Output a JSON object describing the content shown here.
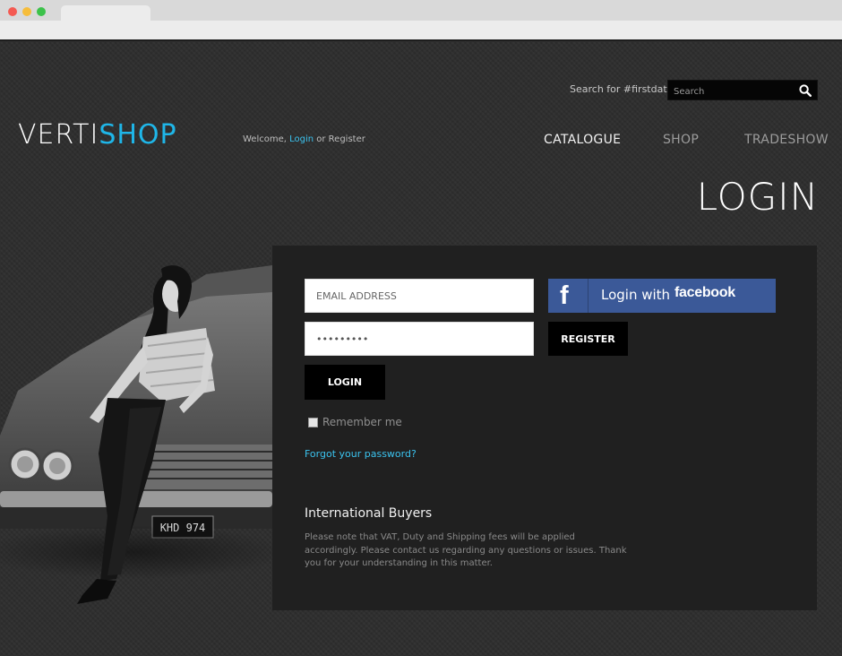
{
  "header": {
    "search_label": "Search for #firstdate",
    "search_placeholder": "Search",
    "welcome_prefix": "Welcome, ",
    "welcome_login": "Login",
    "welcome_suffix": " or Register"
  },
  "logo": {
    "part1": "VERTI",
    "part2": "SHOP"
  },
  "nav": {
    "items": [
      {
        "label": "CATALOGUE"
      },
      {
        "label": "SHOP"
      },
      {
        "label": "TRADESHOW"
      }
    ]
  },
  "page": {
    "title": "LOGIN"
  },
  "form": {
    "email_placeholder": "EMAIL ADDRESS",
    "password_value": "•••••••••",
    "login_label": "LOGIN",
    "register_label": "REGISTER",
    "facebook_prefix": "Login with",
    "facebook_brand": "facebook",
    "remember_label": "Remember me",
    "forgot_label": "Forgot your password?"
  },
  "photo": {
    "plate": "KHD 974"
  },
  "international": {
    "title": "International Buyers",
    "text": "Please note that VAT, Duty and Shipping fees will be applied accordingly. Please contact us regarding any questions or issues. Thank you for your understanding in this matter."
  },
  "colors": {
    "accent": "#1fb6e8",
    "link": "#3bc3ef",
    "facebook": "#3b5998",
    "background": "#2f2f2f",
    "panel": "#202020"
  }
}
